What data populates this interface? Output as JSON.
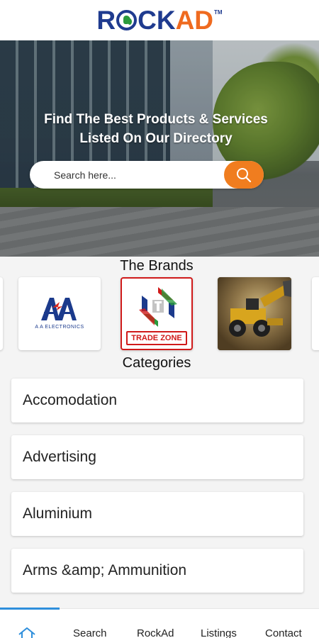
{
  "header": {
    "logo_ro": "R",
    "logo_ck": "CK",
    "logo_ad": "AD",
    "logo_tm": "TM"
  },
  "hero": {
    "title_line1": "Find The Best Products & Services",
    "title_line2": "Listed On Our Directory",
    "search_placeholder": "Search here...",
    "search_button_color": "#f07d1f"
  },
  "brands": {
    "title": "The Brands",
    "items": [
      {
        "name": "A A ELECTRONICS",
        "subtitle": ""
      },
      {
        "name": "TRADE ZONE"
      },
      {
        "name": "",
        "caption": ""
      }
    ]
  },
  "categories": {
    "title": "Categories",
    "items": [
      {
        "label": "Accomodation"
      },
      {
        "label": "Advertising"
      },
      {
        "label": "Aluminium"
      },
      {
        "label": "Arms &amp; Ammunition"
      }
    ]
  },
  "bottom_nav": {
    "active_color": "#2f8fdc",
    "items": [
      {
        "label": "",
        "icon": "home-icon"
      },
      {
        "label": "Search"
      },
      {
        "label": "RockAd"
      },
      {
        "label": "Listings"
      },
      {
        "label": "Contact"
      }
    ]
  },
  "colors": {
    "brand_blue": "#1f3b8f",
    "brand_orange": "#ef6a1f"
  }
}
